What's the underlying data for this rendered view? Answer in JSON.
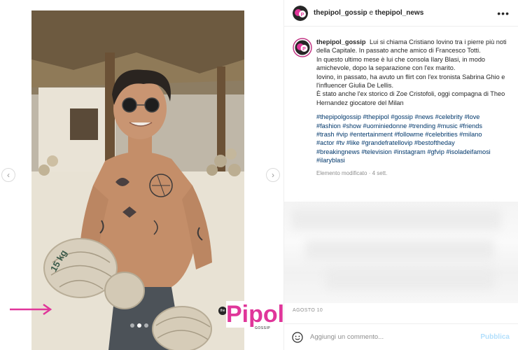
{
  "header": {
    "user1": "thepipol_gossip",
    "conjunction": "e",
    "user2": "thepipol_news",
    "more_icon": "more-horizontal-icon"
  },
  "post": {
    "username": "thepipol_gossip",
    "caption_lines": [
      "Lui si chiama Cristiano Iovino tra i pierre più noti della Capitale. In passato anche amico di Francesco Totti.",
      "In questo ultimo mese è lui che consola Ilary Blasi, in modo amichevole, dopo la separazione con l'ex marito.",
      "Iovino, in passato, ha avuto un flirt con l'ex tronista Sabrina Ghio e l'influencer Giulia De Lellis.",
      "È stato anche l'ex storico di Zoe Cristofoli, oggi compagna di Theo Hernandez giocatore del Milan"
    ],
    "hashtag_lines": [
      "#thepipolgossip #thepipol #gossip #news #celebrity #love",
      "#fashion #show #uominiedonne #trending #music #friends",
      "#trash #vip #entertainment #followme #celebrities #milano",
      "#actor #tv #like #grandefratellovip #bestoftheday",
      "#breakingnews #television #instagram #gfvip #isoladeifamosi",
      "#ilaryblasi"
    ],
    "edited": "Elemento modificato · 4 sett.",
    "date": "AGOSTO 10"
  },
  "media": {
    "carousel": {
      "count": 3,
      "active": 2
    },
    "brand": {
      "letter": "P",
      "name": "Pipol",
      "sub": "GOSSIP",
      "the": "the"
    },
    "basket_text": "15 kg"
  },
  "comment": {
    "placeholder": "Aggiungi un commento...",
    "publish_label": "Pubblica"
  },
  "colors": {
    "brand_pink": "#e0369a",
    "link_blue": "#00376b",
    "muted": "#8e8e8e",
    "publish_disabled": "#b2dffc"
  }
}
